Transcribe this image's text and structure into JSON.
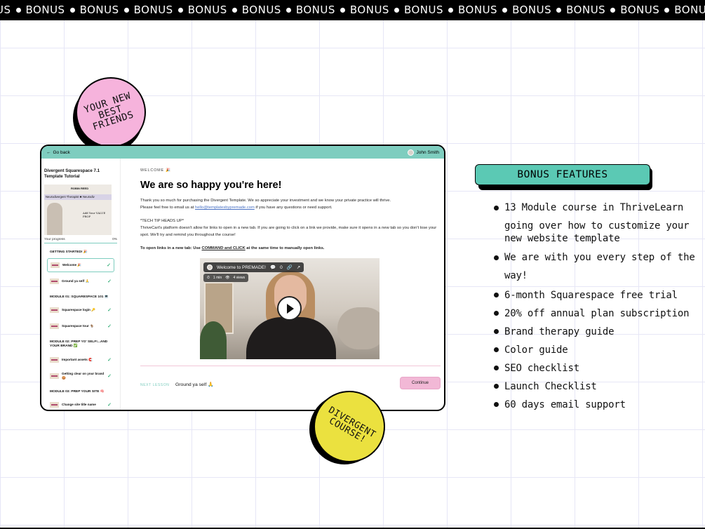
{
  "ticker": {
    "words": [
      "US",
      "BONUS",
      "BONUS",
      "BONUS",
      "BONUS",
      "BONUS",
      "BONUS",
      "BONUS",
      "BONUS",
      "BONUS",
      "BONUS",
      "BONUS",
      "BONUS",
      "BONUS"
    ]
  },
  "badges": {
    "top": "YOUR NEW\nBEST\nFRIENDS",
    "bottom": "DIVERGENT\nCOURSE!"
  },
  "colors": {
    "teal": "#7ecdbf",
    "bonus_teal": "#5bc9b4",
    "pink": "#f6b3dc",
    "yellow": "#ebe13f",
    "continue_pink": "#f2b8d6"
  },
  "course_window": {
    "go_back": "Go back",
    "user_name": "John Smith",
    "sidebar": {
      "course_title": "Divergent Squarespace 7.1 Template Tutorial",
      "thumb_logo": "ROBIN REED",
      "thumb_banner": "Neurodivergent Therapist ✱ Neurodiv",
      "thumb_caption": "Add Your VALUE PROP",
      "progress_label": "Your progress",
      "progress_value": "0%",
      "modules": [
        {
          "title": "GETTING STARTED! 🎉",
          "lessons": [
            {
              "label": "Welcome 🎉",
              "active": true
            },
            {
              "label": "Ground ya self 🙏",
              "active": false
            }
          ]
        },
        {
          "title": "MODULE 01: SQUARESPACE 101 💻",
          "lessons": [
            {
              "label": "Squarespace login 🔑",
              "active": false
            },
            {
              "label": "Squarespace tour 🐐",
              "active": false
            }
          ]
        },
        {
          "title": "MODULE 02: PREP YO' SELF!...AND YOUR BRAND ✅",
          "lessons": [
            {
              "label": "Important assets 🧲",
              "active": false
            },
            {
              "label": "Getting clear on your brand 🍪",
              "active": false
            }
          ]
        },
        {
          "title": "MODULE 03: PREP YOUR SITE 🧠",
          "lessons": [
            {
              "label": "Change site title name",
              "active": false
            }
          ]
        }
      ]
    },
    "main": {
      "eyebrow": "WELCOME 🎉",
      "heading": "We are so happy you're here!",
      "para1_a": "Thank you so much for purchasing the Divergent Template. We so appreciate your investment and we know your private practice will thrive.",
      "para1_b_pre": "Please feel free to email us at ",
      "para1_email": "hello@templatesbypremade.com",
      "para1_b_post": " if you have any questions or need support.",
      "tip_title": "*TECH TIP HEADS UP*",
      "tip_body": "ThriveCart's platform doesn't allow for links to open in a new tab. If you are going to click on a link we provide, make sure it opens in a new tab so you don't lose your spot. We'll try and remind you throughout the course!",
      "new_tab_pre": "To open links in a new tab: Use ",
      "new_tab_cmd": "COMMAND and CLICK",
      "new_tab_post": " at the same time to manually open links.",
      "video": {
        "title": "Welcome to PREMADE!",
        "comments": "0",
        "duration": "1 min",
        "views": "4 views"
      },
      "next_label": "NEXT LESSON",
      "next_title": "Ground ya self 🙏",
      "continue_label": "Continue"
    }
  },
  "bonus": {
    "title": "BONUS FEATURES",
    "features": [
      {
        "l1": "13 Module course in ThriveLearn",
        "l2": "going over how to customize your new website template"
      },
      {
        "l1": "We are with you every step of the",
        "l2": "way!"
      },
      {
        "l1": "6-month Squarespace free trial"
      },
      {
        "l1": "20% off annual plan subscription"
      },
      {
        "l1": "Brand therapy guide"
      },
      {
        "l1": "Color guide"
      },
      {
        "l1": "SEO checklist"
      },
      {
        "l1": "Launch Checklist"
      },
      {
        "l1": "60 days email support"
      }
    ]
  }
}
